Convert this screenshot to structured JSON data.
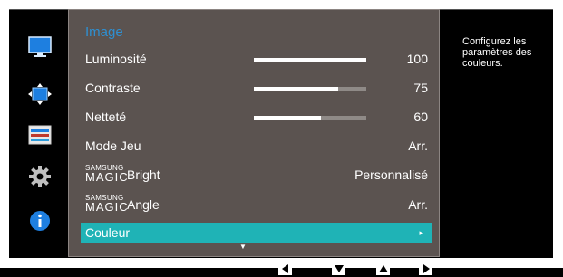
{
  "menu": {
    "title": "Image",
    "items": [
      {
        "label": "Luminosité",
        "value": "100",
        "slider": 100
      },
      {
        "label": "Contraste",
        "value": "75",
        "slider": 75
      },
      {
        "label": "Netteté",
        "value": "60",
        "slider": 60
      },
      {
        "label": "Mode Jeu",
        "value": "Arr."
      },
      {
        "label_prefix_small": "SAMSUNG",
        "label_prefix_big": "MAGIC",
        "label": "Bright",
        "value": "Personnalisé"
      },
      {
        "label_prefix_small": "SAMSUNG",
        "label_prefix_big": "MAGIC",
        "label": "Angle",
        "value": "Arr."
      },
      {
        "label": "Couleur",
        "value": "▸",
        "selected": true
      }
    ],
    "scroll_indicator": "▼"
  },
  "help_text": "Configurez les paramètres des couleurs.",
  "sidebar": {
    "icons": [
      "monitor-icon",
      "resize-icon",
      "settings-bars-icon",
      "gear-icon",
      "info-icon"
    ]
  },
  "nav": {
    "buttons": [
      "left-arrow-icon",
      "down-arrow-icon",
      "up-arrow-icon",
      "right-arrow-icon"
    ]
  },
  "colors": {
    "accent": "#1fb3b6",
    "title": "#2f8fd0",
    "panel": "#5b5350",
    "background": "#000000"
  }
}
